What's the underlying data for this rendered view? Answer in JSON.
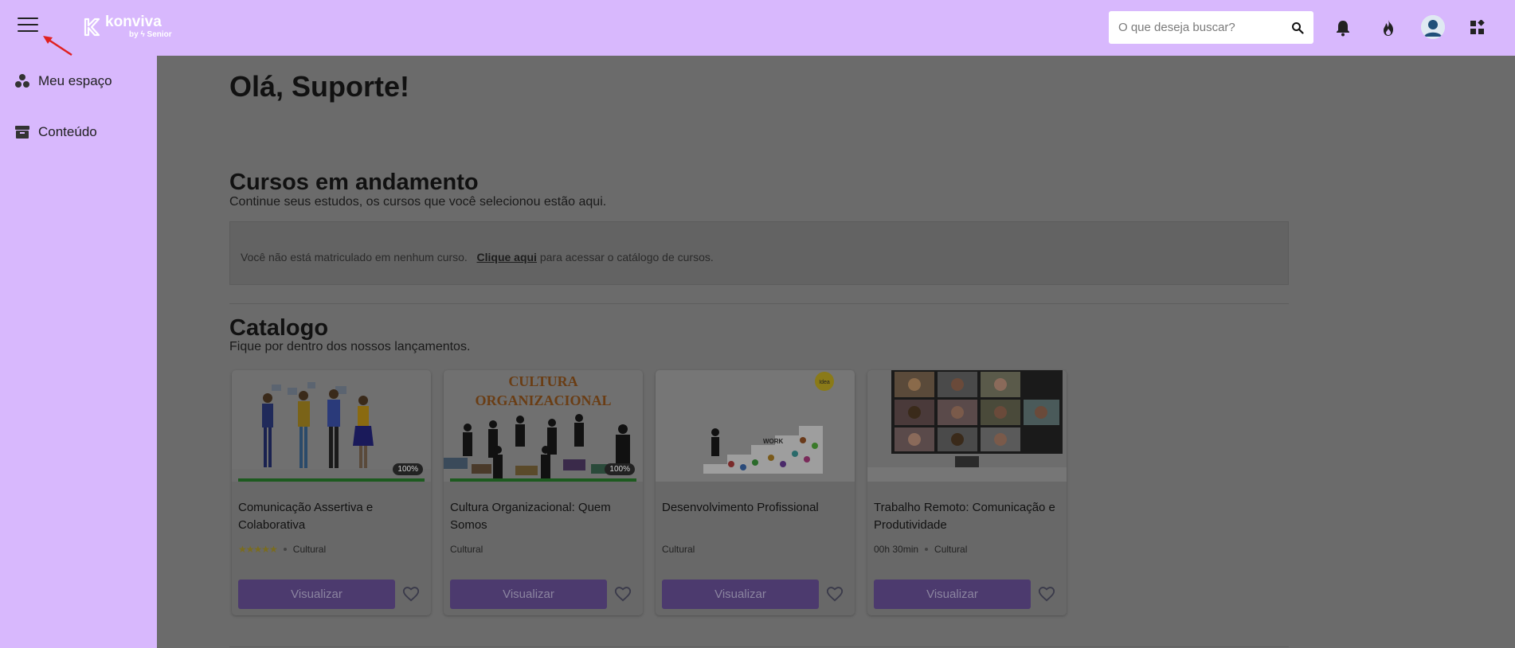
{
  "topbar": {
    "logo_name": "konviva",
    "logo_sub": "by ϟ Senior",
    "search_placeholder": "O que deseja buscar?"
  },
  "icons": {
    "menu": "hamburger-menu-icon",
    "search": "search-icon",
    "bell": "bell-icon",
    "flame": "flame-icon",
    "avatar": "user-avatar",
    "apps": "apps-grid-icon"
  },
  "colors": {
    "topbar_bg": "#d8b8fd",
    "sidebar_bg": "#d8b8fd",
    "overlay_bg": "#6b6b6b",
    "button_bg": "#4c3a6e",
    "arrow": "#e02020"
  },
  "sidebar": {
    "items": [
      {
        "label": "Meu espaço",
        "icon": "circles-icon"
      },
      {
        "label": "Conteúdo",
        "icon": "archive-icon"
      }
    ]
  },
  "main": {
    "greeting": "Olá, Suporte!",
    "in_progress": {
      "title": "Cursos em andamento",
      "subtitle": "Continue seus estudos, os cursos que você selecionou estão aqui.",
      "notice_before": "Você não está matriculado em nenhum curso.",
      "notice_link": "Clique aqui",
      "notice_after": " para acessar o catálogo de cursos."
    },
    "catalog": {
      "title": "Catalogo",
      "subtitle": "Fique por dentro dos nossos lançamentos.",
      "cards": [
        {
          "title": "Comunicação Assertiva e Colaborativa",
          "progress_label": "100%",
          "progress": 1.0,
          "rating_stars": "★★★★★",
          "duration": "",
          "category": "Cultural",
          "button": "Visualizar"
        },
        {
          "title": "Cultura Organizacional: Quem Somos",
          "image_text_1": "CULTURA",
          "image_text_2": "ORGANIZACIONAL",
          "progress_label": "100%",
          "progress": 1.0,
          "rating_stars": "",
          "duration": "",
          "category": "Cultural",
          "button": "Visualizar"
        },
        {
          "title": "Desenvolvimento Profissional",
          "image_text_1": "Idea",
          "image_text_2": "WORK",
          "progress_label": "",
          "rating_stars": "",
          "duration": "",
          "category": "Cultural",
          "button": "Visualizar"
        },
        {
          "title": "Trabalho Remoto: Comunicação e Produtividade",
          "progress_label": "",
          "rating_stars": "",
          "duration": "00h 30min",
          "category": "Cultural",
          "button": "Visualizar"
        }
      ]
    }
  }
}
